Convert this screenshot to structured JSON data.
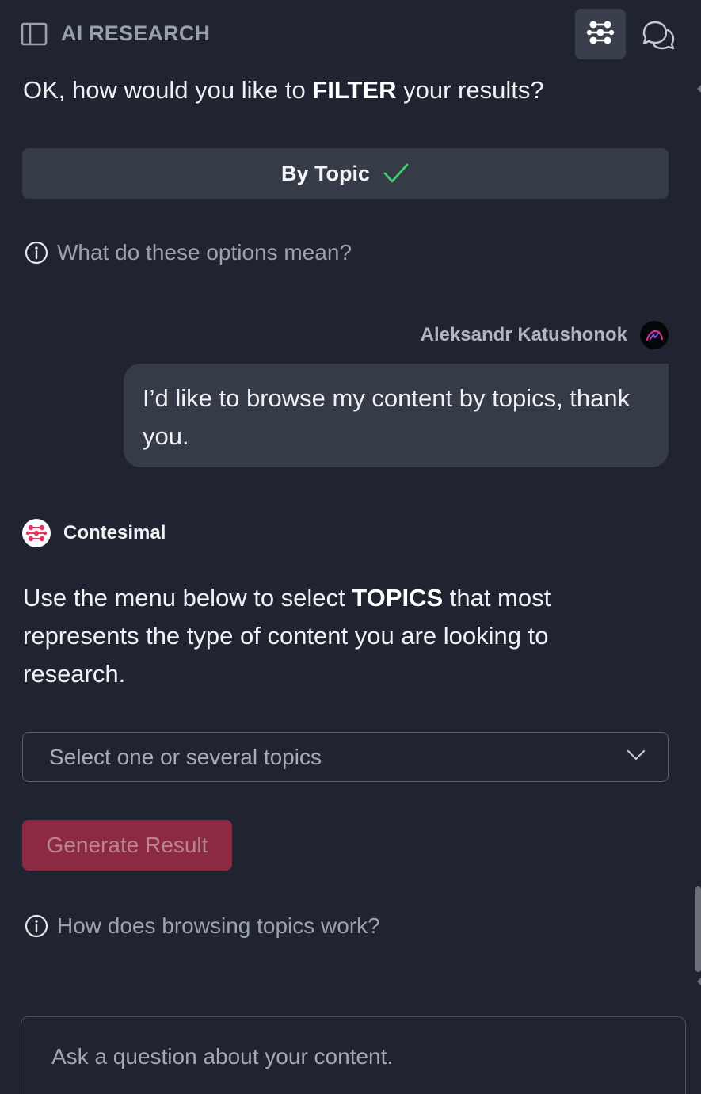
{
  "header": {
    "title": "AI RESEARCH",
    "icons": {
      "sidebar_toggle": "sidebar-panel-icon",
      "research": "contesimal-network-icon",
      "chat": "chat-bubbles-icon"
    }
  },
  "filter_prompt": {
    "before": "OK, how would you like to ",
    "bold": "FILTER",
    "after": " your results?"
  },
  "selected_option": {
    "label": "By Topic",
    "icon": "check-icon",
    "check_color": "#3fcf6a"
  },
  "help_options": {
    "icon": "info-icon",
    "text": "What do these options mean?"
  },
  "user": {
    "name": "Aleksandr Katushonok",
    "message": "I’d like to browse my content by topics, thank you."
  },
  "bot": {
    "name": "Contesimal",
    "logo_color": "#e8345f",
    "message_before": "Use the menu below to select ",
    "message_bold": "TOPICS",
    "message_after": " that most represents the type of content you are looking to research."
  },
  "topic_select": {
    "placeholder": "Select one or several topics",
    "icon": "chevron-down-icon"
  },
  "generate_button": {
    "label": "Generate Result"
  },
  "help_topics": {
    "icon": "info-icon",
    "text": "How does browsing topics work?"
  },
  "ask_input": {
    "placeholder": "Ask a question about your content.",
    "value": ""
  },
  "colors": {
    "background": "#1f2430",
    "surface": "#363b48",
    "brand_red": "#8c2a44",
    "muted_text": "#9da3ad"
  }
}
